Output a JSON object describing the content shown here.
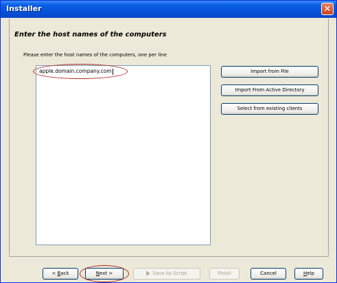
{
  "window": {
    "title": "Installer"
  },
  "header": {
    "heading": "Enter the host names of the computers"
  },
  "main": {
    "instruction": "Please enter the host names of the computers, one per line",
    "host_value": "apple.domain.company.com"
  },
  "side_buttons": {
    "import_file": "Import from File",
    "import_ad": "Import From Active Directory",
    "select_existing": "Select from existing clients"
  },
  "footer": {
    "back_prefix": "< ",
    "back_key": "B",
    "back_rest": "ack",
    "next_key": "N",
    "next_rest": "ext >",
    "save_script": "Save As Script",
    "finish": "Finish",
    "cancel": "Cancel",
    "help_key": "H",
    "help_rest": "elp"
  },
  "icons": {
    "close": "close-icon",
    "script": "script-icon"
  },
  "colors": {
    "titlebar": "#0550d8",
    "highlight": "#b0281e",
    "dialog_bg": "#ece9d8"
  }
}
